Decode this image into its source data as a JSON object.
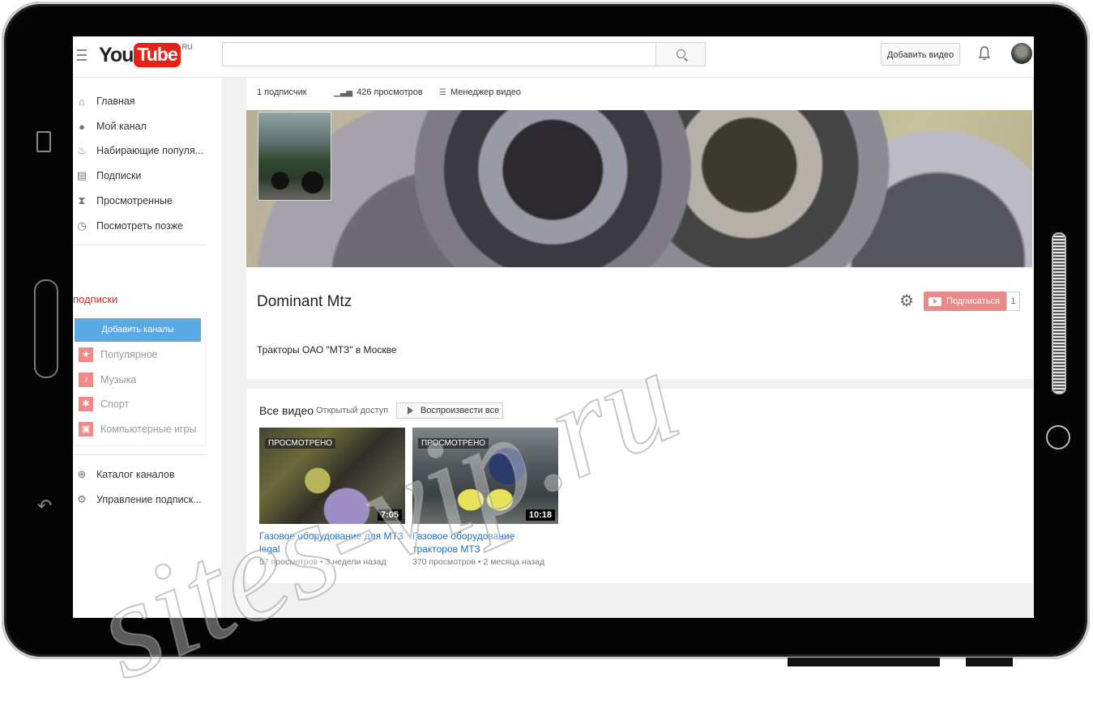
{
  "header": {
    "logo_you": "You",
    "logo_tube": "Tube",
    "logo_region": "RU",
    "search_placeholder": "",
    "upload_label": "Добавить видео"
  },
  "sidebar": {
    "items": [
      {
        "label": "Главная",
        "icon": "home-icon"
      },
      {
        "label": "Мой канал",
        "icon": "account-icon"
      },
      {
        "label": "Набирающие популя...",
        "icon": "flame-icon"
      },
      {
        "label": "Подписки",
        "icon": "subscriptions-icon"
      },
      {
        "label": "Просмотренные",
        "icon": "hourglass-icon"
      },
      {
        "label": "Посмотреть позже",
        "icon": "clock-icon"
      }
    ],
    "subs_title": "подписки",
    "add_channels_label": "Добавить каналы",
    "categories": [
      {
        "label": "Популярное",
        "icon": "star-icon"
      },
      {
        "label": "Музыка",
        "icon": "music-icon"
      },
      {
        "label": "Спорт",
        "icon": "ball-icon"
      },
      {
        "label": "Компьютерные игры",
        "icon": "gamepad-icon"
      }
    ],
    "bottom_items": [
      {
        "label": "Каталог каналов",
        "icon": "plus-circle-icon"
      },
      {
        "label": "Управление подписк...",
        "icon": "gear-icon"
      }
    ]
  },
  "channel": {
    "stats": {
      "subscribers": "1 подписчик",
      "views": "426 просмотров",
      "manager": "Менеджер видео"
    },
    "title": "Dominant Mtz",
    "description": "Тракторы ОАО \"МТЗ\" в Москве",
    "subscribe_label": "Подписаться",
    "subscriber_count": "1"
  },
  "videos_section": {
    "title": "Все видео",
    "access": "Открытый доступ",
    "play_all_label": "Воспроизвести все",
    "videos": [
      {
        "watched_label": "ПРОСМОТРЕНО",
        "duration": "7:05",
        "title": "Газовое оборудование для МТЗ legal",
        "meta": "57 просмотров • 3 недели назад"
      },
      {
        "watched_label": "ПРОСМОТРЕНО",
        "duration": "10:18",
        "title": "Газовое оборудование тракторов МТЗ",
        "meta": "370 просмотров • 2 месяца назад"
      }
    ]
  },
  "watermark": "sites-vip.ru"
}
